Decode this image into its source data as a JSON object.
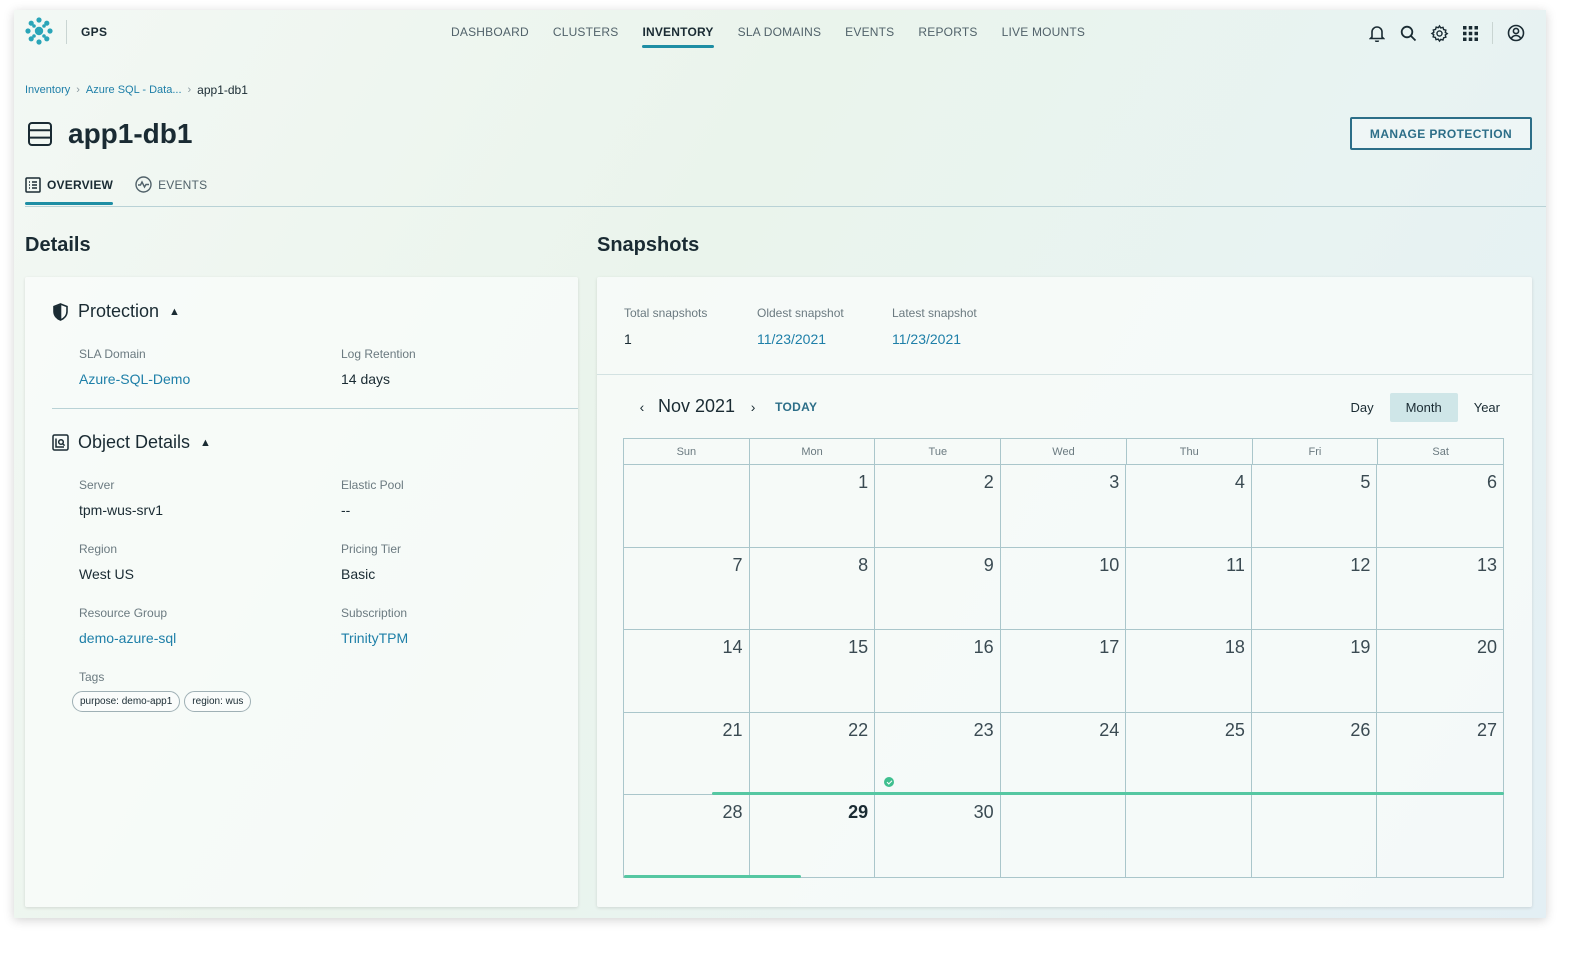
{
  "app": {
    "product": "GPS"
  },
  "nav": {
    "links": [
      "DASHBOARD",
      "CLUSTERS",
      "INVENTORY",
      "SLA DOMAINS",
      "EVENTS",
      "REPORTS",
      "LIVE MOUNTS"
    ],
    "active": "INVENTORY",
    "icons": [
      "bell-icon",
      "search-icon",
      "gear-icon",
      "app-grid-icon",
      "user-avatar-icon"
    ]
  },
  "breadcrumb": {
    "items": [
      "Inventory",
      "Azure SQL - Data..."
    ],
    "current": "app1-db1"
  },
  "page": {
    "title": "app1-db1",
    "manage_button": "MANAGE PROTECTION",
    "tabs": [
      "OVERVIEW",
      "EVENTS"
    ],
    "active_tab": "OVERVIEW"
  },
  "details": {
    "heading": "Details",
    "protection": {
      "heading": "Protection",
      "sla_domain_label": "SLA Domain",
      "sla_domain_value": "Azure-SQL-Demo",
      "log_retention_label": "Log Retention",
      "log_retention_value": "14 days"
    },
    "object_details": {
      "heading": "Object Details",
      "server_label": "Server",
      "server_value": "tpm-wus-srv1",
      "elastic_pool_label": "Elastic Pool",
      "elastic_pool_value": "--",
      "region_label": "Region",
      "region_value": "West US",
      "pricing_tier_label": "Pricing Tier",
      "pricing_tier_value": "Basic",
      "resource_group_label": "Resource Group",
      "resource_group_value": "demo-azure-sql",
      "subscription_label": "Subscription",
      "subscription_value": "TrinityTPM",
      "tags_label": "Tags",
      "tags": [
        "purpose: demo-app1",
        "region: wus"
      ]
    }
  },
  "snapshots": {
    "heading": "Snapshots",
    "total_label": "Total snapshots",
    "total_value": "1",
    "oldest_label": "Oldest snapshot",
    "oldest_value": "11/23/2021",
    "latest_label": "Latest snapshot",
    "latest_value": "11/23/2021",
    "calendar": {
      "month_label": "Nov 2021",
      "today_label": "TODAY",
      "views": [
        "Day",
        "Month",
        "Year"
      ],
      "active_view": "Month",
      "weekdays": [
        "Sun",
        "Mon",
        "Tue",
        "Wed",
        "Thu",
        "Fri",
        "Sat"
      ],
      "first_weekday_index": 1,
      "days_in_month": 30,
      "today_day": 29,
      "snapshot_days": [
        23
      ]
    }
  },
  "colors": {
    "accent": "#1e8ea4",
    "link": "#1e7fa8",
    "snapshot_green": "#3fbf8f"
  }
}
